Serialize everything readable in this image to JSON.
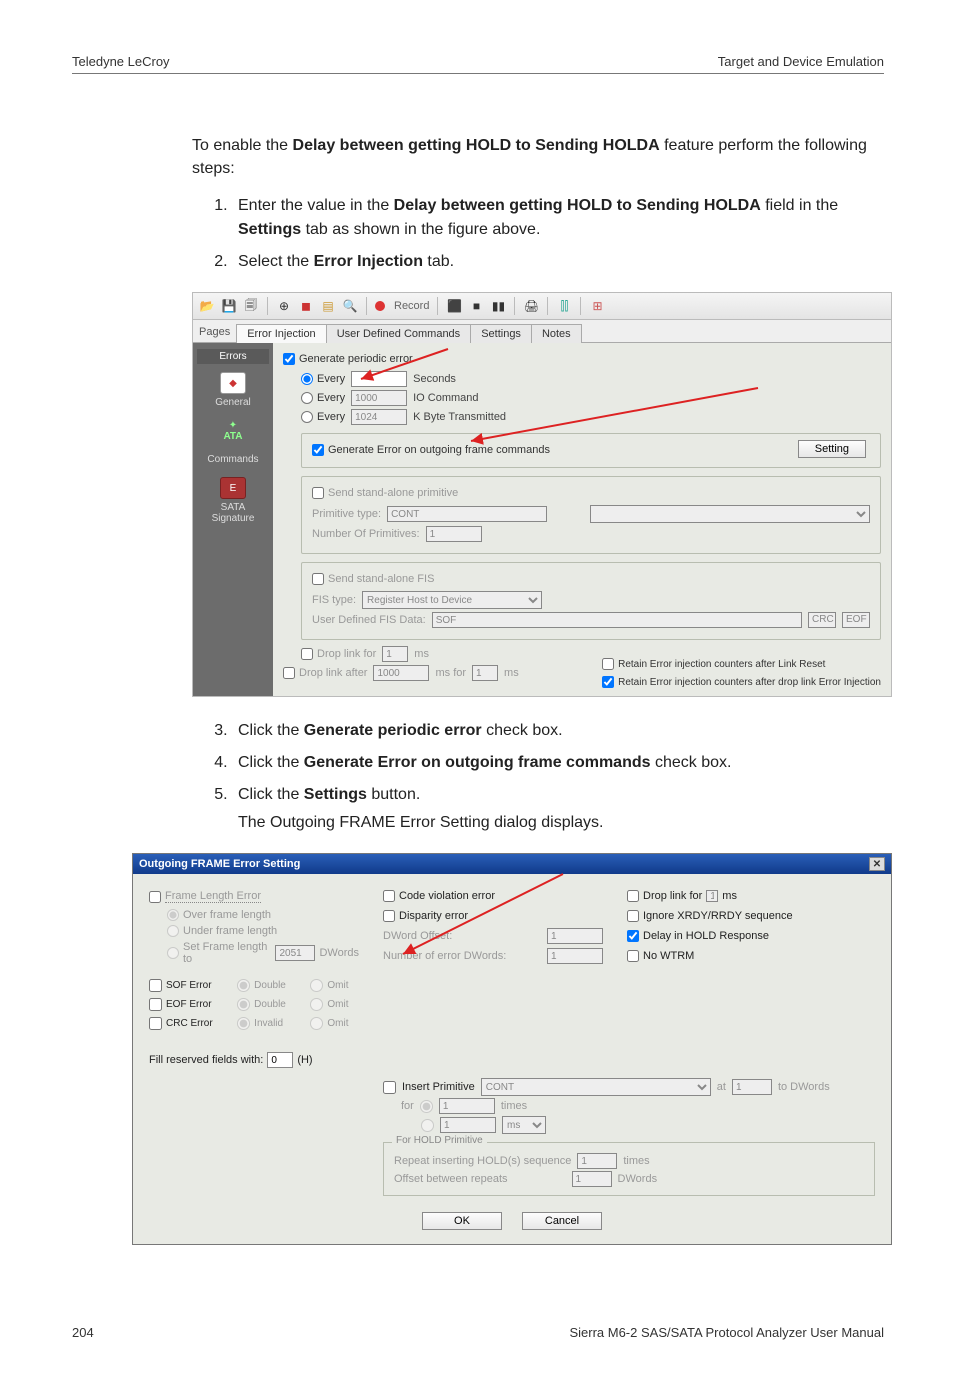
{
  "header": {
    "left": "Teledyne LeCroy",
    "right": "Target and Device Emulation"
  },
  "intro": {
    "pre": "To enable the ",
    "bold": "Delay between getting HOLD to Sending HOLDA",
    "post": " feature perform the following steps:"
  },
  "steps": {
    "s1a": "Enter the value in the ",
    "s1b": "Delay between getting HOLD to Sending HOLDA",
    "s1c": " field in the ",
    "s1d": "Settings",
    "s1e": " tab as shown in the figure above.",
    "s2a": "Select the ",
    "s2b": "Error Injection",
    "s2c": " tab.",
    "s3a": "Click the ",
    "s3b": "Generate periodic error",
    "s3c": " check box.",
    "s4a": "Click the ",
    "s4b": "Generate Error on outgoing frame commands",
    "s4c": " check box.",
    "s5a": "Click the ",
    "s5b": "Settings",
    "s5c": " button.",
    "s5sub": "The Outgoing FRAME Error Setting dialog displays."
  },
  "app": {
    "record": "Record",
    "pages_label": "Pages",
    "tabs": [
      "Error Injection",
      "User Defined Commands",
      "Settings",
      "Notes"
    ],
    "sidebar": {
      "header": "Errors",
      "general": "General",
      "ata": "ATA",
      "commands": "Commands",
      "sata": "SATA",
      "signature": "Signature"
    },
    "gen_periodic": "Generate periodic error",
    "every": "Every",
    "seconds_lbl": "Seconds",
    "io_cmd_val": "1000",
    "io_cmd_lbl": "IO Command",
    "kbyte_val": "1024",
    "kbyte_lbl": "K Byte Transmitted",
    "gen_outgoing": "Generate Error on outgoing frame commands",
    "setting_btn": "Setting",
    "send_prim": "Send stand-alone primitive",
    "prim_type_lbl": "Primitive type:",
    "prim_type_val": "CONT",
    "num_prim_lbl": "Number Of Primitives:",
    "num_prim_val": "1",
    "send_fis": "Send stand-alone FIS",
    "fis_type_lbl": "FIS type:",
    "fis_type_val": "Register Host to Device",
    "ud_fis_lbl": "User Defined FIS Data:",
    "ud_fis_val": "SOF",
    "crc": "CRC",
    "eof": "EOF",
    "drop1": "Drop link for",
    "drop1_val": "1",
    "ms": "ms",
    "drop2": "Drop link after",
    "drop2_val": "1000",
    "ms_for": "ms for",
    "drop2b_val": "1",
    "retain1": "Retain Error injection counters after Link Reset",
    "retain2": "Retain Error injection counters after drop link Error Injection"
  },
  "dlg": {
    "title": "Outgoing FRAME Error Setting",
    "frame_len": "Frame Length Error",
    "over": "Over frame length",
    "under": "Under frame length",
    "setlen": "Set Frame length to",
    "setlen_val": "2051",
    "dwords": "DWords",
    "sof": "SOF Error",
    "eof": "EOF Error",
    "crc": "CRC Error",
    "double": "Double",
    "omit": "Omit",
    "invalid": "Invalid",
    "fill": "Fill reserved fields with:",
    "fill_val": "0",
    "fill_unit": "(H)",
    "code_v": "Code violation error",
    "disp": "Disparity error",
    "dwoff": "DWord Offset:",
    "dwoff_val": "1",
    "numerr": "Number of error DWords:",
    "numerr_val": "1",
    "ins": "Insert Primitive",
    "ins_val": "CONT",
    "at": "at",
    "at_val": "1",
    "to": "to DWords",
    "for": "for",
    "for_val": "1",
    "times": "times",
    "ms_sel": "ms",
    "hold_legend": "For HOLD Primitive",
    "hold_rep": "Repeat inserting HOLD(s) sequence",
    "hold_rep_val": "1",
    "hold_times": "times",
    "hold_off": "Offset between repeats",
    "hold_off_val": "1",
    "hold_dw": "DWords",
    "drop": "Drop link for",
    "drop_val": "1",
    "drop_ms": "ms",
    "ignore": "Ignore XRDY/RRDY sequence",
    "delay": "Delay in HOLD Response",
    "nowtrm": "No WTRM",
    "ok": "OK",
    "cancel": "Cancel"
  },
  "footer": {
    "page": "204",
    "manual": "Sierra M6-2 SAS/SATA Protocol Analyzer User Manual"
  }
}
